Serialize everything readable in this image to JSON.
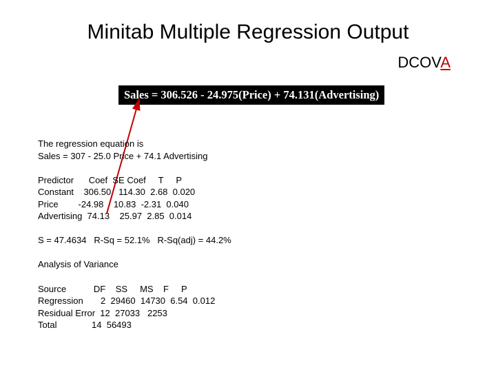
{
  "title": "Minitab Multiple Regression Output",
  "dcova": {
    "prefix": "DCOV",
    "A": "A"
  },
  "equation": "Sales = 306.526 - 24.975(Price) + 74.131(Advertising)",
  "reg_intro_1": "The regression equation is",
  "reg_intro_2": "Sales = 307 - 25.0 Price + 74.1 Advertising",
  "coef_header": "Predictor      Coef  SE Coef     T     P",
  "coef_rows": [
    "Constant    306.50   114.30  2.68  0.020",
    "Price        -24.98    10.83  -2.31  0.040",
    "Advertising  74.13    25.97  2.85  0.014"
  ],
  "stats_line": "S = 47.4634   R-Sq = 52.1%   R-Sq(adj) = 44.2%",
  "anova_title": "Analysis of Variance",
  "anova_header": "Source           DF    SS     MS    F     P",
  "anova_rows": [
    "Regression       2  29460  14730  6.54  0.012",
    "Residual Error  12  27033   2253",
    "Total              14  56493"
  ],
  "chart_data": {
    "type": "table",
    "title": "Minitab Multiple Regression Output",
    "equation": "Sales = 306.526 - 24.975(Price) + 74.131(Advertising)",
    "simplified_equation": "Sales = 307 - 25.0 Price + 74.1 Advertising",
    "coefficients": {
      "columns": [
        "Predictor",
        "Coef",
        "SE Coef",
        "T",
        "P"
      ],
      "rows": [
        [
          "Constant",
          306.5,
          114.3,
          2.68,
          0.02
        ],
        [
          "Price",
          -24.98,
          10.83,
          -2.31,
          0.04
        ],
        [
          "Advertising",
          74.13,
          25.97,
          2.85,
          0.014
        ]
      ]
    },
    "summary": {
      "S": 47.4634,
      "R_Sq_pct": 52.1,
      "R_Sq_adj_pct": 44.2
    },
    "anova": {
      "columns": [
        "Source",
        "DF",
        "SS",
        "MS",
        "F",
        "P"
      ],
      "rows": [
        [
          "Regression",
          2,
          29460,
          14730,
          6.54,
          0.012
        ],
        [
          "Residual Error",
          12,
          27033,
          2253,
          null,
          null
        ],
        [
          "Total",
          14,
          56493,
          null,
          null,
          null
        ]
      ]
    }
  }
}
